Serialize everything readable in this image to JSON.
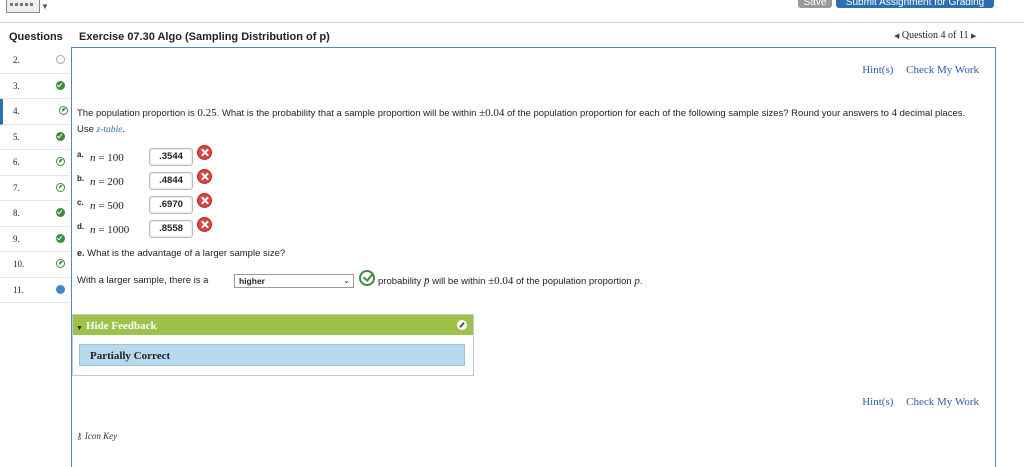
{
  "toolbar": {
    "save_label": "Save",
    "submit_label": "Submit Assignment for Grading"
  },
  "sidebar": {
    "header": "Questions",
    "items": [
      {
        "num": "2.",
        "status": "empty"
      },
      {
        "num": "3.",
        "status": "check"
      },
      {
        "num": "4.",
        "status": "partial"
      },
      {
        "num": "5.",
        "status": "check"
      },
      {
        "num": "6.",
        "status": "partial"
      },
      {
        "num": "7.",
        "status": "partial"
      },
      {
        "num": "8.",
        "status": "check"
      },
      {
        "num": "9.",
        "status": "check"
      },
      {
        "num": "10.",
        "status": "partial"
      },
      {
        "num": "11.",
        "status": "current"
      }
    ]
  },
  "exercise": {
    "title": "Exercise 07.30 Algo (Sampling Distribution of p)",
    "nav": "Question 4 of 11"
  },
  "links": {
    "hint": "Hint(s)",
    "check": "Check My Work"
  },
  "question": {
    "p1": "The population proportion is ",
    "pval": "0.25",
    "p2": ". What is the probability that a sample proportion will be within ",
    "tol": "±0.04",
    "p3": " of the population proportion for each of the following sample sizes? Round your answers to ",
    "dp": "4",
    "p4": " decimal places. Use ",
    "table_link": "z-table",
    "p5": "."
  },
  "parts": [
    {
      "label": "a.",
      "var": "n",
      "eq": " = ",
      "n": "100",
      "answer": ".3544"
    },
    {
      "label": "b.",
      "var": "n",
      "eq": " = ",
      "n": "200",
      "answer": ".4844"
    },
    {
      "label": "c.",
      "var": "n",
      "eq": " = ",
      "n": "500",
      "answer": ".6970"
    },
    {
      "label": "d.",
      "var": "n",
      "eq": " = ",
      "n": "1000",
      "answer": ".8558"
    }
  ],
  "part_e": {
    "label": "e.",
    "question": "What is the advantage of a larger sample size?",
    "prefix": "With a larger sample, there is a ",
    "selected": "higher",
    "suffix1": " probability ",
    "pbar": "p̄",
    "suffix2": " will be within ",
    "tol": "±0.04",
    "suffix3": " of the population proportion ",
    "p": "p",
    "suffix4": "."
  },
  "feedback": {
    "header": "Hide Feedback",
    "result": "Partially Correct"
  },
  "footer": {
    "icon_key": "Icon Key"
  },
  "colors": {
    "accent_blue": "#2a6fb0",
    "correct_green": "#3d8b3d",
    "incorrect_red": "#d9443c",
    "feedback_green": "#9cc24a",
    "feedback_blue": "#b8d8ec"
  },
  "icons": [
    "keyboard-icon",
    "check-circle-icon",
    "x-circle-icon",
    "pencil-icon",
    "key-icon"
  ]
}
